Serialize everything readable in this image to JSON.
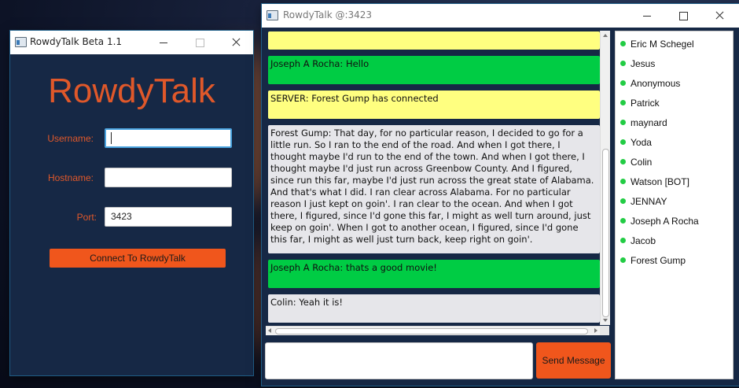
{
  "login_window": {
    "title": "RowdyTalk Beta 1.1",
    "brand": "RowdyTalk",
    "username_label": "Username:",
    "username_value": "",
    "hostname_label": "Hostname:",
    "hostname_value": "",
    "port_label": "Port:",
    "port_value": "3423",
    "connect_label": "Connect To RowdyTalk"
  },
  "chat_window": {
    "title": "RowdyTalk @:3423",
    "messages": [
      {
        "text": "",
        "color": "#ffff80"
      },
      {
        "text": "Joseph A Rocha: Hello",
        "color": "#00cc44"
      },
      {
        "text": "SERVER: Forest Gump has connected",
        "color": "#ffff80"
      },
      {
        "text": "Forest Gump: That day, for no particular reason, I decided to go for a little run. So I ran to the end of the road. And when I got there, I thought maybe I'd run to the end of the town. And when I got there, I thought maybe I'd just run across Greenbow County. And I figured, since run this far, maybe I'd just run across the great state of Alabama. And that's what I did. I ran clear across Alabama. For no particular reason I just kept on goin'. I ran clear to the ocean. And when I got there, I figured, since I'd gone this far, I might as well turn around, just keep on goin'. When I got to another ocean, I figured, since I'd gone this far, I might as well just turn back, keep right on goin'.",
        "color": "#e6e6ea"
      },
      {
        "text": "Joseph A Rocha: thats a good movie!",
        "color": "#00cc44"
      },
      {
        "text": "Colin: Yeah it is!",
        "color": "#e6e6ea"
      }
    ],
    "message_input_value": "",
    "send_label": "Send Message",
    "users": [
      "Eric M Schegel",
      "Jesus",
      "Anonymous",
      "Patrick",
      "maynard",
      "Yoda",
      "Colin",
      "Watson [BOT]",
      "JENNAY",
      "Joseph A Rocha",
      "Jacob",
      "Forest Gump"
    ],
    "online_color": "#22cc44"
  }
}
